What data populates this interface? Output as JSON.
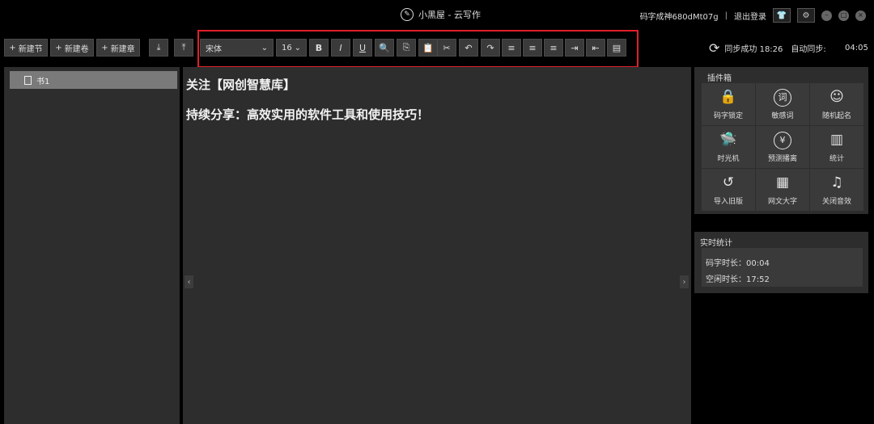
{
  "titlebar": {
    "app_title": "小黑屋 - 云写作",
    "logo_glyph": "✎",
    "username": "码字成神680dMt07g",
    "separator": "|",
    "logout": "退出登录",
    "skin_glyph": "👕",
    "settings_glyph": "⚙",
    "min_glyph": "–",
    "max_glyph": "□",
    "close_glyph": "×"
  },
  "toolbar": {
    "new_section": "新建节",
    "new_volume": "新建卷",
    "new_chapter": "新建章",
    "plus": "+",
    "import_glyph": "⤓",
    "export_glyph": "⤒",
    "font": "宋体",
    "font_size": "16",
    "dropdown_glyph": "⌄",
    "bold": "B",
    "italic": "I",
    "underline": "U",
    "search_glyph": "🔍",
    "copy_glyph": "⎘",
    "paste_glyph": "📋",
    "cut_glyph": "✂",
    "undo_glyph": "↶",
    "redo_glyph": "↷",
    "align_left_glyph": "≡",
    "align_center_glyph": "≡",
    "align_right_glyph": "≡",
    "indent_glyph": "⇥",
    "outdent_glyph": "⇤",
    "fullscreen_glyph": "▤"
  },
  "sync": {
    "icon_glyph": "⟳",
    "status": "同步成功 18:26",
    "auto_label": "自动同步:",
    "countdown": "04:05"
  },
  "sidebar": {
    "chapter": "书1"
  },
  "editor": {
    "line1": "关注【网创智慧库】",
    "line2": "持续分享：高效实用的软件工具和使用技巧！",
    "left_arrow": "‹",
    "right_arrow": "›"
  },
  "plugins": {
    "title": "插件箱",
    "items": [
      {
        "label": "码字锁定",
        "glyph": "🔒"
      },
      {
        "label": "敏感词",
        "glyph": "词"
      },
      {
        "label": "随机起名",
        "glyph": "☺"
      },
      {
        "label": "时光机",
        "glyph": "🛸"
      },
      {
        "label": "预测播离",
        "glyph": "¥"
      },
      {
        "label": "统计",
        "glyph": "▥"
      },
      {
        "label": "导入旧版",
        "glyph": "↺"
      },
      {
        "label": "网文大字",
        "glyph": "▦"
      },
      {
        "label": "关闭音效",
        "glyph": "♫"
      }
    ]
  },
  "stats": {
    "title": "实时统计",
    "typing_time": "码字时长：00:04",
    "idle_time": "空闲时长：17:52"
  }
}
